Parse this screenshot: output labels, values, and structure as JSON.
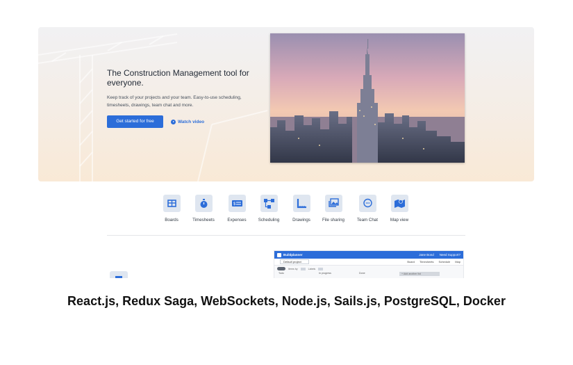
{
  "hero": {
    "title": "The Construction Management tool for everyone.",
    "subtitle": "Keep track of your projects and your team. Easy-to-use scheduling, timesheets, drawings, team chat and more.",
    "cta_label": "Get started for free",
    "video_label": "Watch video"
  },
  "features": [
    {
      "label": "Boards",
      "icon": "boards-icon"
    },
    {
      "label": "Timesheets",
      "icon": "stopwatch-icon"
    },
    {
      "label": "Expenses",
      "icon": "expenses-icon"
    },
    {
      "label": "Scheduling",
      "icon": "scheduling-icon"
    },
    {
      "label": "Drawings",
      "icon": "ruler-icon"
    },
    {
      "label": "File sharing",
      "icon": "image-gallery-icon"
    },
    {
      "label": "Team Chat",
      "icon": "chat-icon"
    },
    {
      "label": "Map view",
      "icon": "map-icon"
    }
  ],
  "app_preview": {
    "brand": "Buildplanner",
    "user": "Jane Bond",
    "support": "Need Support?",
    "project": "Default project",
    "tabs": [
      "Board",
      "Timesheets",
      "Schedule",
      "Map"
    ],
    "filter_labels": [
      "Items by",
      "Labels"
    ],
    "columns": [
      "Todo",
      "In progress",
      "Done"
    ],
    "add_column": "+ Add another list"
  },
  "caption": "React.js, Redux Saga, WebSockets, Node.js, Sails.js, PostgreSQL, Docker",
  "colors": {
    "accent": "#2c6dd9",
    "icon_bg": "#dfe6f0",
    "text": "#1f2733"
  }
}
